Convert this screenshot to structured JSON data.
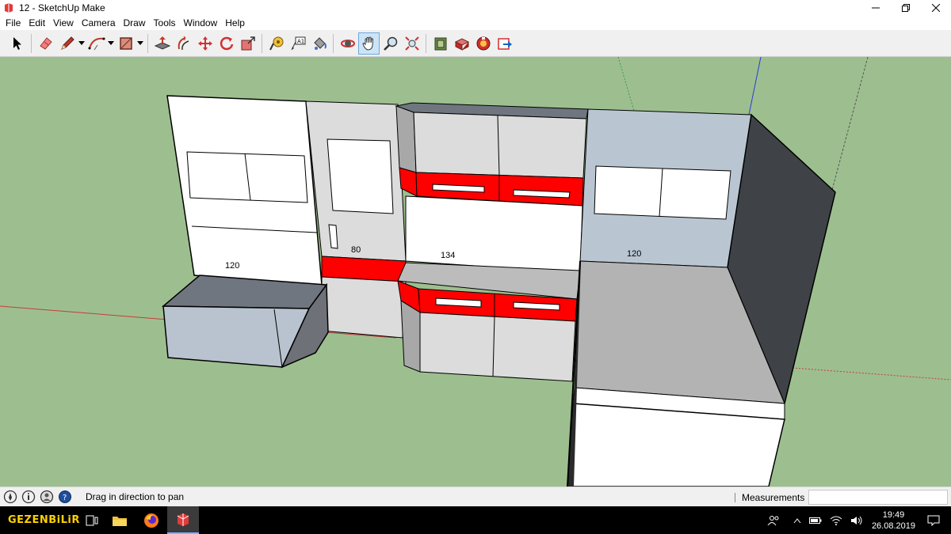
{
  "window": {
    "title": "12 - SketchUp Make"
  },
  "menu": [
    "File",
    "Edit",
    "View",
    "Camera",
    "Draw",
    "Tools",
    "Window",
    "Help"
  ],
  "toolbar": [
    {
      "name": "select-tool",
      "icon": "select-arrow-icon"
    },
    {
      "name": "eraser-tool",
      "icon": "eraser-icon"
    },
    {
      "name": "line-tool",
      "icon": "pencil-icon",
      "dropdown": true
    },
    {
      "name": "arc-tool",
      "icon": "arc-icon",
      "dropdown": true
    },
    {
      "name": "rectangle-tool",
      "icon": "rectangle-icon",
      "dropdown": true
    },
    {
      "name": "push-pull-tool",
      "icon": "push-pull-icon"
    },
    {
      "name": "offset-tool",
      "icon": "offset-icon"
    },
    {
      "name": "move-tool",
      "icon": "move-icon"
    },
    {
      "name": "rotate-tool",
      "icon": "rotate-icon"
    },
    {
      "name": "scale-tool",
      "icon": "scale-icon"
    },
    {
      "name": "tape-measure-tool",
      "icon": "tape-measure-icon"
    },
    {
      "name": "text-tool",
      "icon": "text-icon"
    },
    {
      "name": "paint-bucket-tool",
      "icon": "paint-bucket-icon"
    },
    {
      "name": "orbit-tool",
      "icon": "orbit-icon"
    },
    {
      "name": "pan-tool",
      "icon": "pan-hand-icon",
      "active": true
    },
    {
      "name": "zoom-tool",
      "icon": "zoom-icon"
    },
    {
      "name": "zoom-extents-tool",
      "icon": "zoom-extents-icon"
    },
    {
      "name": "3d-warehouse",
      "icon": "warehouse-icon"
    },
    {
      "name": "extension-warehouse",
      "icon": "extension-icon"
    },
    {
      "name": "layout-send",
      "icon": "layout-icon"
    },
    {
      "name": "share-model",
      "icon": "share-icon"
    }
  ],
  "viewport": {
    "dimension_labels": [
      "120",
      "80",
      "134",
      "120"
    ]
  },
  "status": {
    "hint": "Drag in direction to pan",
    "measurements_label": "Measurements",
    "measurements_value": ""
  },
  "taskbar": {
    "brand": "GEZENBiLiR",
    "time": "19:49",
    "date": "26.08.2019"
  },
  "colors": {
    "accent_red": "#ff0000",
    "ground": "#9dbf8f",
    "sky": "#ffffff"
  }
}
